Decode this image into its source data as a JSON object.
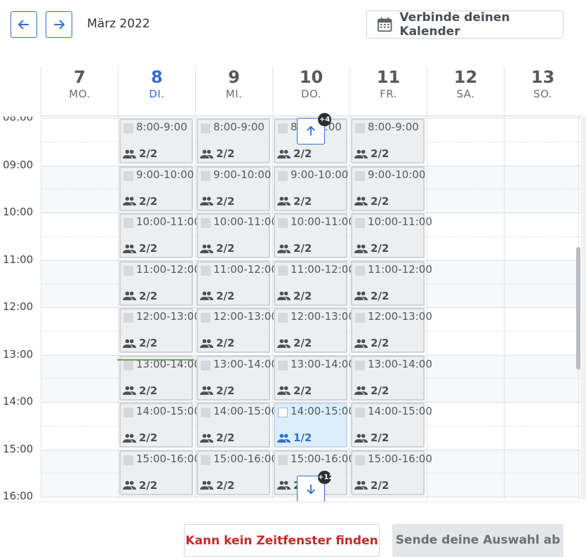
{
  "nav": {
    "prev_icon": "arrow-left-icon",
    "next_icon": "arrow-right-icon",
    "month_label": "März 2022"
  },
  "connect_calendar": {
    "label": "Verbinde deinen Kalender",
    "icon": "calendar-icon"
  },
  "days": [
    {
      "num": "7",
      "weekday": "MO."
    },
    {
      "num": "8",
      "weekday": "DI."
    },
    {
      "num": "9",
      "weekday": "MI."
    },
    {
      "num": "10",
      "weekday": "DO."
    },
    {
      "num": "11",
      "weekday": "FR."
    },
    {
      "num": "12",
      "weekday": "SA."
    },
    {
      "num": "13",
      "weekday": "SO."
    }
  ],
  "today_index": 1,
  "hours": [
    "08:00",
    "09:00",
    "10:00",
    "11:00",
    "12:00",
    "13:00",
    "14:00",
    "15:00",
    "16:00"
  ],
  "slot_columns": [
    1,
    2,
    3,
    4
  ],
  "slots": [
    {
      "time": "8:00-9:00",
      "capacity": "2/2"
    },
    {
      "time": "9:00-10:00",
      "capacity": "2/2"
    },
    {
      "time": "10:00-11:00",
      "capacity": "2/2"
    },
    {
      "time": "11:00-12:00",
      "capacity": "2/2"
    },
    {
      "time": "12:00-13:00",
      "capacity": "2/2"
    },
    {
      "time": "13:00-14:00",
      "capacity": "2/2"
    },
    {
      "time": "14:00-15:00",
      "capacity": "2/2"
    },
    {
      "time": "15:00-16:00",
      "capacity": "2/2"
    }
  ],
  "special_slot": {
    "day_index": 3,
    "row_index": 6,
    "time": "14:00-15:00",
    "capacity": "1/2"
  },
  "scroll_up": {
    "count": "+4",
    "icon": "arrow-up-icon"
  },
  "scroll_down": {
    "count": "+12",
    "icon": "arrow-down-icon"
  },
  "footer": {
    "cant_find_label": "Kann kein Zeitfenster finden",
    "send_label": "Sende deine Auswahl ab"
  },
  "colors": {
    "accent": "#2f6fd1",
    "danger": "#c62828",
    "now_line": "#6aa84f"
  }
}
